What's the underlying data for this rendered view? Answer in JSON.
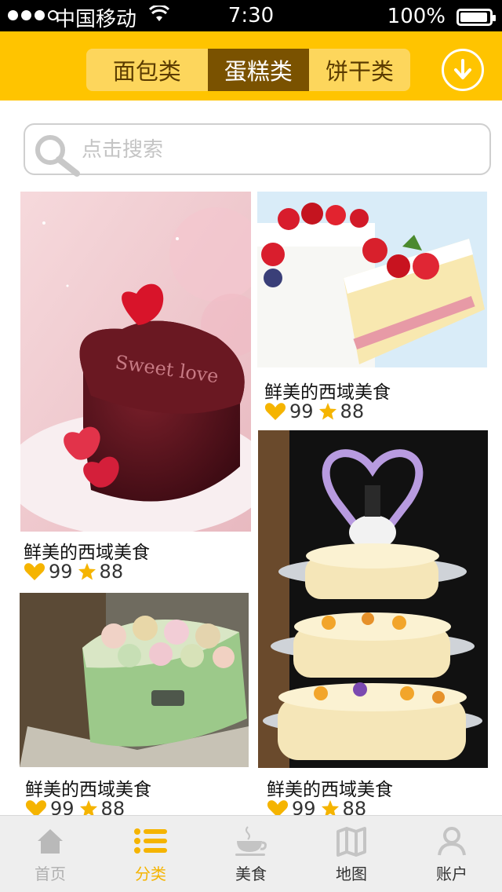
{
  "status_bar": {
    "carrier": "中国移动",
    "time": "7:30",
    "battery": "100%"
  },
  "header": {
    "tabs": [
      {
        "label": "面包类",
        "active": false
      },
      {
        "label": "蛋糕类",
        "active": true
      },
      {
        "label": "饼干类",
        "active": false
      }
    ],
    "download_icon": "download-circle-icon"
  },
  "search": {
    "placeholder": "点击搜索",
    "value": ""
  },
  "products": [
    {
      "title": "鲜美的西域美食",
      "likes": "99",
      "stars": "88",
      "image": "heart-chocolate-cake"
    },
    {
      "title": "鲜美的西域美食",
      "likes": "99",
      "stars": "88",
      "image": "strawberry-cream-cake"
    },
    {
      "title": "鲜美的西域美食",
      "likes": "99",
      "stars": "88",
      "image": "rose-heart-cake"
    },
    {
      "title": "鲜美的西域美食",
      "likes": "99",
      "stars": "88",
      "image": "wedding-tier-cake"
    }
  ],
  "tab_bar": [
    {
      "label": "首页",
      "icon": "home-icon",
      "state": "muted"
    },
    {
      "label": "分类",
      "icon": "list-icon",
      "state": "active"
    },
    {
      "label": "美食",
      "icon": "cup-icon",
      "state": "normal"
    },
    {
      "label": "地图",
      "icon": "map-icon",
      "state": "normal"
    },
    {
      "label": "账户",
      "icon": "user-icon",
      "state": "normal"
    }
  ],
  "colors": {
    "accent": "#ffc400",
    "tab_active": "#7a5200",
    "icon_yellow": "#f5b400"
  }
}
